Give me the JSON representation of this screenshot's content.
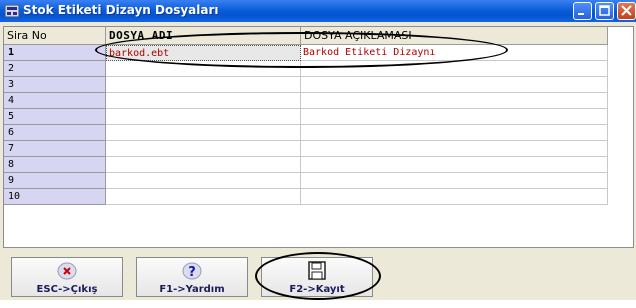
{
  "window": {
    "title": "Stok Etiketi Dizayn Dosyaları",
    "controls": {
      "minimize": "minimize-icon",
      "maximize": "maximize-icon",
      "close": "close-icon"
    }
  },
  "grid": {
    "columns": [
      "Sira No",
      "DOSYA ADI",
      "DOSYA AÇIKLAMASI"
    ],
    "row_numbers": [
      "1",
      "2",
      "3",
      "4",
      "5",
      "6",
      "7",
      "8",
      "9",
      "10"
    ],
    "rows": [
      {
        "file": "barkod.ebt",
        "desc": "Barkod Etiketi Dizaynı"
      }
    ],
    "selected_row": 1,
    "colors": {
      "row_header": "#d6d6f2",
      "cell_text": "#b00000"
    }
  },
  "buttons": [
    {
      "label": "ESC->Çıkış",
      "icon": "close-circle-icon"
    },
    {
      "label": "F1->Yardım",
      "icon": "help-icon"
    },
    {
      "label": "F2->Kayıt",
      "icon": "floppy-disk-icon"
    }
  ]
}
